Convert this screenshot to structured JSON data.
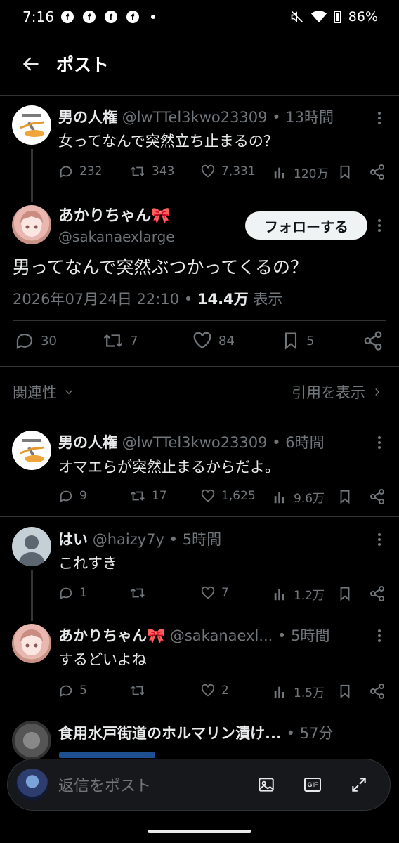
{
  "status": {
    "time": "7:16",
    "fb_icon": "f",
    "battery": "86%"
  },
  "header": {
    "title": "ポスト"
  },
  "quote_tweet": {
    "name": "男の人権",
    "handle": "@lwTTel3kwo23309",
    "time": "13時間",
    "text": "女ってなんで突然立ち止まるの？",
    "replies": "232",
    "reposts": "343",
    "likes": "7,331",
    "views": "120万"
  },
  "main_tweet": {
    "name": "あかりちゃん🎀",
    "handle": "@sakanaexlarge",
    "follow_label": "フォローする",
    "text": "男ってなんで突然ぶつかってくるの？",
    "datetime": "2026年07月24日 22:10",
    "views_count": "14.4万",
    "views_label": "表示",
    "replies": "30",
    "reposts": "7",
    "likes": "84",
    "bookmarks": "5"
  },
  "sort": {
    "left_label": "関連性",
    "right_label": "引用を表示"
  },
  "replies": [
    {
      "name": "男の人権",
      "handle": "@lwTTel3kwo23309",
      "time": "6時間",
      "text": "オマエらが突然止まるからだよ。",
      "replies": "9",
      "reposts": "17",
      "likes": "1,625",
      "views": "9.6万"
    },
    {
      "name": "はい",
      "handle": "@haizy7y",
      "time": "5時間",
      "text": "これすき",
      "replies": "1",
      "reposts": "",
      "likes": "7",
      "views": "1.2万"
    },
    {
      "name": "あかりちゃん🎀",
      "handle": "@sakanaexl...",
      "time": "5時間",
      "text": "するどいよね",
      "replies": "5",
      "reposts": "",
      "likes": "2",
      "views": "1.5万"
    },
    {
      "name": "食用水戸街道のホルマリン漬け...",
      "time": "57分"
    }
  ],
  "reply_bar": {
    "placeholder": "返信をポスト"
  },
  "colors": {
    "background": "#000000",
    "text": "#e7e9ea",
    "muted": "#71767b",
    "divider": "#2f3336"
  }
}
